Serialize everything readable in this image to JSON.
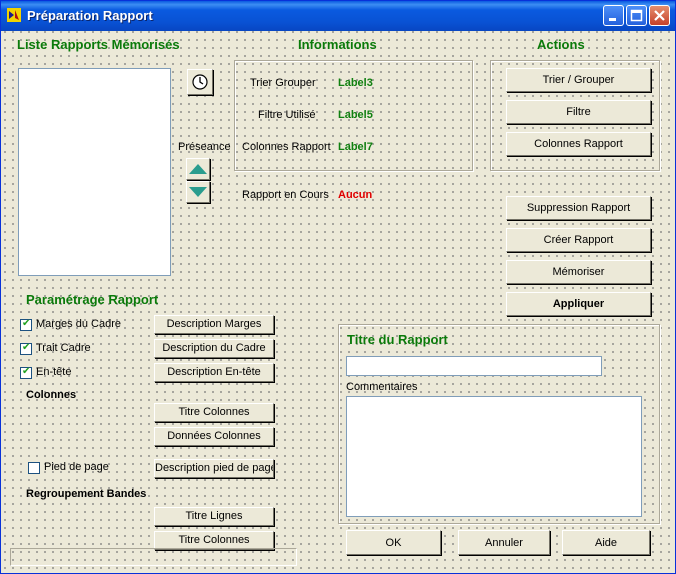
{
  "window": {
    "title": "Préparation Rapport"
  },
  "liste": {
    "heading": "Liste Rapports Mémorisés",
    "preseance_label": "Préseance"
  },
  "informations": {
    "heading": "Informations",
    "rows": [
      {
        "label": "Trier Grouper",
        "value": "Label3"
      },
      {
        "label": "Filtre Utilisé",
        "value": "Label5"
      },
      {
        "label": "Colonnes Rapport",
        "value": "Label7"
      }
    ],
    "current_label": "Rapport en Cours",
    "current_value": "Aucun",
    "colors": {
      "value": "#108010",
      "current": "#e00000"
    }
  },
  "actions": {
    "heading": "Actions",
    "buttons": [
      "Trier / Grouper",
      "Filtre",
      "Colonnes Rapport"
    ],
    "buttons2": [
      "Suppression Rapport",
      "Créer Rapport",
      "Mémoriser",
      "Appliquer"
    ]
  },
  "parametrage": {
    "heading": "Paramétrage Rapport",
    "checks": [
      {
        "label": "Marges du Cadre",
        "checked": true,
        "button": "Description Marges"
      },
      {
        "label": "Trait Cadre",
        "checked": true,
        "button": "Description du Cadre"
      },
      {
        "label": "En-tête",
        "checked": true,
        "button": "Description En-tête"
      }
    ],
    "colonnes_heading": "Colonnes",
    "colonnes_buttons": [
      "Titre Colonnes",
      "Données Colonnes"
    ],
    "pied": {
      "label": "Pied de page",
      "checked": false,
      "button": "Description pied de page"
    },
    "regroupement_heading": "Regroupement Bandes",
    "regroupement_buttons": [
      "Titre Lignes",
      "Titre Colonnes"
    ]
  },
  "titre": {
    "heading": "Titre du Rapport",
    "title_value": "",
    "commentaires_label": "Commentaires",
    "commentaires_value": ""
  },
  "footer": {
    "ok": "OK",
    "annuler": "Annuler",
    "aide": "Aide"
  },
  "theme": {
    "accent_heading": "#0a7a0a",
    "titlebar": "#0a5ae0",
    "face": "#ece9d8"
  }
}
